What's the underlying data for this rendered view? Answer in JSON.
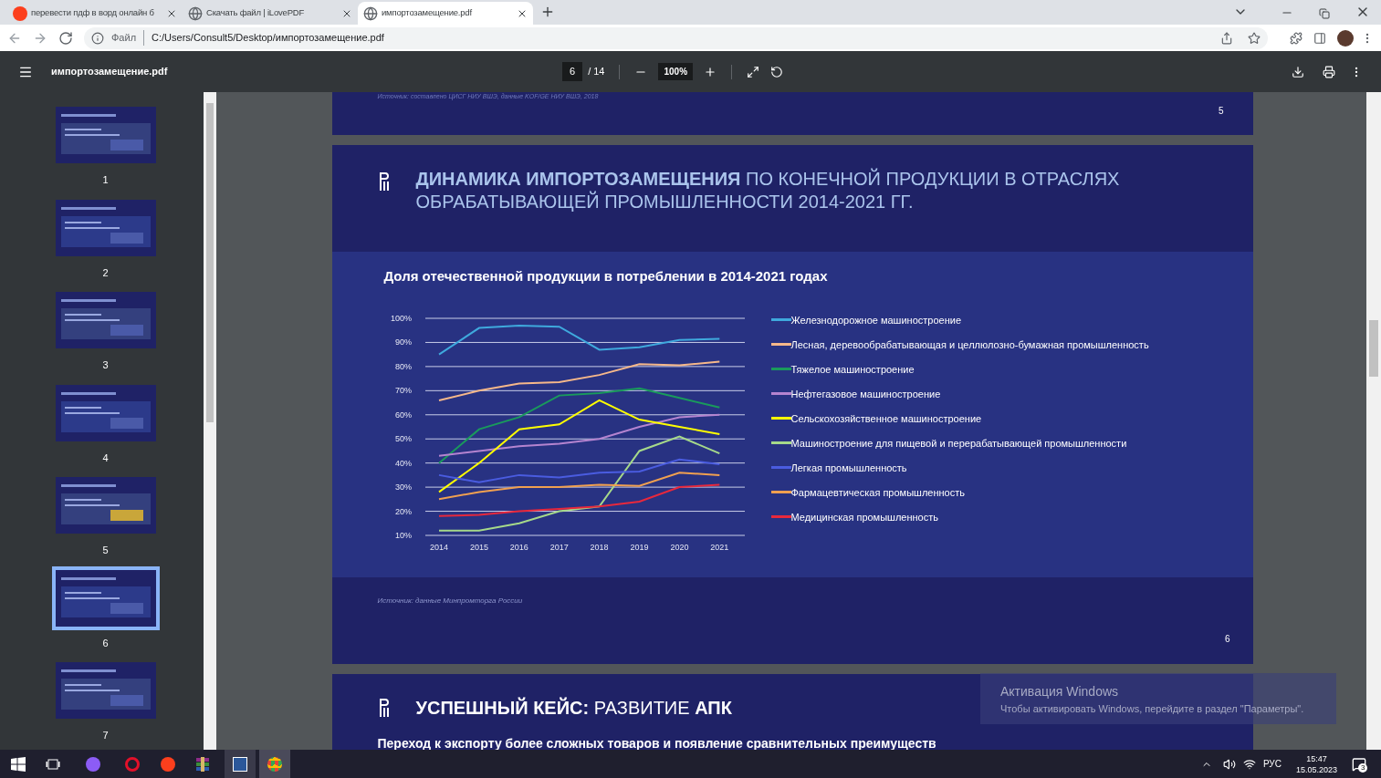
{
  "browser": {
    "tabs": [
      {
        "title": "перевести пдф в ворд онлайн б",
        "kind": "yandex",
        "selected": false
      },
      {
        "title": "Скачать файл | iLovePDF",
        "kind": "globe",
        "selected": false
      },
      {
        "title": "импортозамещение.pdf",
        "kind": "globe",
        "selected": true
      }
    ],
    "address": {
      "scheme": "Файл",
      "url": "C:/Users/Consult5/Desktop/импортозамещение.pdf"
    }
  },
  "pdf_viewer": {
    "file_name": "импортозамещение.pdf",
    "page_current": "6",
    "page_total": "/ 14",
    "zoom": "100%"
  },
  "thumbnails": [
    {
      "label": "1",
      "selected": false
    },
    {
      "label": "2",
      "selected": false
    },
    {
      "label": "3",
      "selected": false
    },
    {
      "label": "4",
      "selected": false
    },
    {
      "label": "5",
      "selected": false
    },
    {
      "label": "6",
      "selected": true
    },
    {
      "label": "7",
      "selected": false
    }
  ],
  "pages": {
    "page_5": {
      "source": "Источник: составлено ЦИСГ НИУ ВШЭ, данные KOF/GE НИУ ВШЭ, 2018",
      "number": "5"
    },
    "page_6": {
      "title": "**ДИНАМИКА ИМПОРТОЗАМЕЩЕНИЯ** ПО КОНЕЧНОЙ ПРОДУКЦИИ В ОТРАСЛЯХ ОБРАБАТЫВАЮЩЕЙ ПРОМЫШЛЕННОСТИ 2014-2021 ГГ.",
      "source": "Источник: данные Минпромторга России",
      "number": "6",
      "chart_data": {
        "type": "line",
        "grid": true,
        "title": "Доля отечественной продукции в потреблении в 2014-2021 годах",
        "categories": [
          "2014",
          "2015",
          "2016",
          "2017",
          "2018",
          "2019",
          "2020",
          "2021"
        ],
        "ylim": [
          10,
          100
        ],
        "yticks": [
          {
            "value": 10,
            "label": "10%"
          },
          {
            "value": 20,
            "label": "20%"
          },
          {
            "value": 30,
            "label": "30%"
          },
          {
            "value": 40,
            "label": "40%"
          },
          {
            "value": 50,
            "label": "50%"
          },
          {
            "value": 60,
            "label": "60%"
          },
          {
            "value": 70,
            "label": "70%"
          },
          {
            "value": 80,
            "label": "80%"
          },
          {
            "value": 90,
            "label": "90%"
          },
          {
            "value": 100,
            "label": "100%"
          }
        ],
        "series": [
          {
            "name": "Железнодорожное машиностроение",
            "color": "#3fa9dd",
            "values": [
              85,
              96,
              97,
              96.5,
              87,
              88,
              91,
              91.5
            ]
          },
          {
            "name": "Лесная, деревообрабатывающая и целлюлозно-бумажная промышленность",
            "color": "#f6b88a",
            "values": [
              66,
              70,
              73,
              73.5,
              76.5,
              81,
              80.5,
              82
            ]
          },
          {
            "name": "Тяжелое машиностроение",
            "color": "#1a9a5c",
            "values": [
              40,
              54,
              59,
              68,
              69,
              71,
              67,
              63
            ]
          },
          {
            "name": "Нефтегазовое машиностроение",
            "color": "#b584d0",
            "values": [
              43,
              45,
              47,
              48,
              50,
              55,
              59,
              60
            ]
          },
          {
            "name": "Сельскохозяйственное машиностроение",
            "color": "#ffff00",
            "values": [
              28,
              40,
              54,
              56,
              66,
              58,
              55,
              52
            ]
          },
          {
            "name": "Машиностроение для пищевой и перерабатывающей промышленности",
            "color": "#a6d98a",
            "values": [
              12,
              12,
              15,
              20,
              22,
              45,
              51,
              44
            ]
          },
          {
            "name": "Легкая промышленность",
            "color": "#4a5ce0",
            "values": [
              35,
              32,
              35,
              34,
              36,
              36.5,
              41.5,
              39.5
            ]
          },
          {
            "name": "Фармацевтическая промышленность",
            "color": "#f0a050",
            "values": [
              25,
              28,
              30,
              30,
              31,
              30.5,
              36,
              35
            ]
          },
          {
            "name": "Медицинская промышленность",
            "color": "#e8283c",
            "values": [
              18,
              18.5,
              20,
              21,
              22,
              24,
              30,
              31
            ]
          }
        ]
      }
    },
    "page_7": {
      "title": "**УСПЕШНЫЙ КЕЙС:** РАЗВИТИЕ **АПК**",
      "subtitle": "Переход к экспорту более сложных товаров и появление сравнительных преимуществ"
    }
  },
  "activation": {
    "title": "Активация Windows",
    "text": "Чтобы активировать Windows, перейдите в раздел \"Параметры\"."
  },
  "taskbar": {
    "language": "РУС",
    "time": "15:47",
    "date": "15.05.2023",
    "notifications": "3"
  }
}
